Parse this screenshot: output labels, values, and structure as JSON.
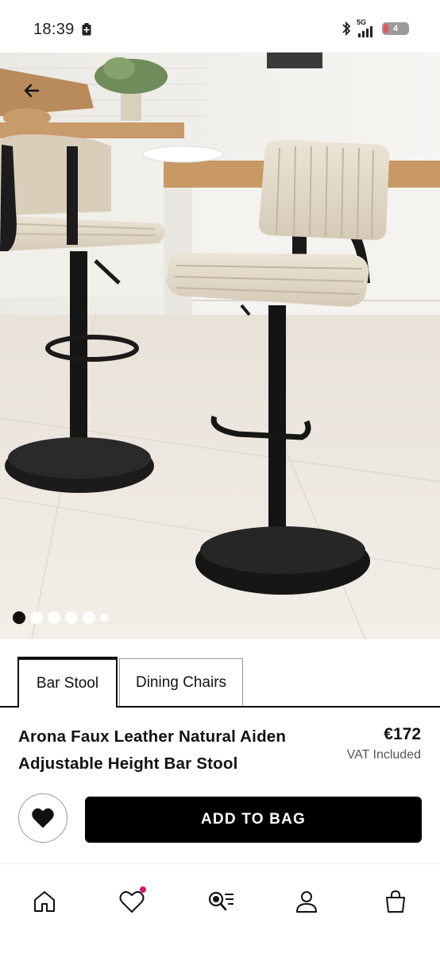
{
  "status_bar": {
    "time": "18:39",
    "network": "5G",
    "battery_level": "4",
    "icons": [
      "battery-saver-icon",
      "bluetooth-icon",
      "signal-icon",
      "battery-icon"
    ]
  },
  "gallery": {
    "back_icon": "back-arrow-icon",
    "image_count": 6,
    "active_index": 0
  },
  "tabs": [
    {
      "label": "Bar Stool",
      "active": true
    },
    {
      "label": "Dining Chairs",
      "active": false
    }
  ],
  "product": {
    "title": "Arona Faux Leather Natural Aiden Adjustable Height Bar Stool",
    "price": "€172",
    "vat_note": "VAT Included"
  },
  "actions": {
    "wishlist_icon": "heart-icon",
    "add_to_bag_label": "ADD TO BAG"
  },
  "bottom_nav": {
    "items": [
      "home-icon",
      "wishlist-icon",
      "search-icon",
      "account-icon",
      "bag-icon"
    ],
    "wishlist_badge_color": "#d8176b"
  },
  "colors": {
    "primary": "#000000",
    "background": "#ffffff",
    "badge": "#d8176b"
  }
}
